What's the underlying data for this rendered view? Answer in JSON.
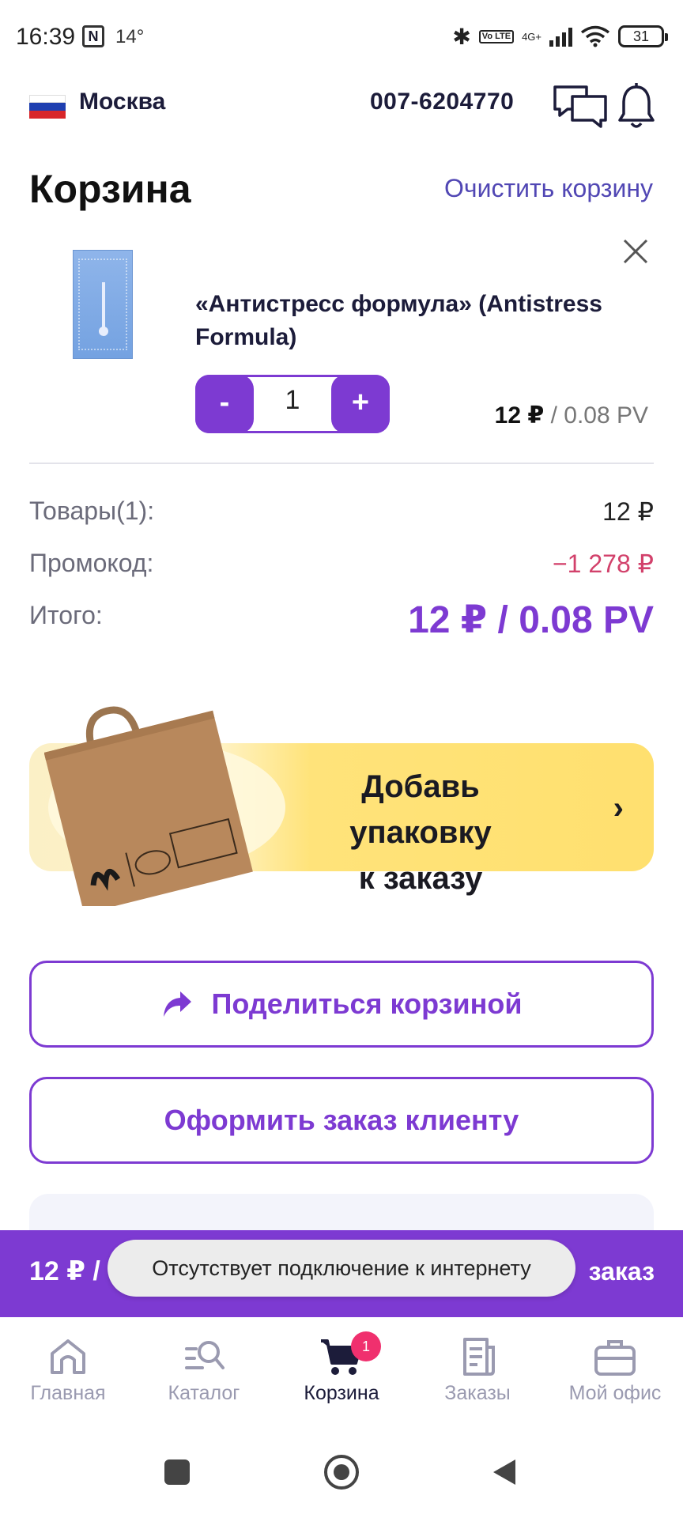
{
  "status_bar": {
    "time": "16:39",
    "nfc": "N",
    "temperature": "14°",
    "network": "4G+",
    "volte": "Vo LTE",
    "battery": "31"
  },
  "header": {
    "city": "Москва",
    "phone": "007-6204770",
    "flag_colors": [
      "#ffffff",
      "#1f3fb0",
      "#d8262a"
    ]
  },
  "page": {
    "title": "Корзина",
    "clear_label": "Очистить корзину"
  },
  "cart_item": {
    "name": "«Антистресс формула» (Antistress Formula)",
    "quantity": "1",
    "minus_label": "-",
    "plus_label": "+",
    "price": "12 ₽",
    "price_pv": " / 0.08 PV"
  },
  "summary": {
    "items_label": "Товары(1):",
    "items_value": "12 ₽",
    "promo_label": "Промокод:",
    "promo_value": "−1 278 ₽",
    "total_label": "Итого:",
    "total_value": "12 ₽ / 0.08 PV"
  },
  "packaging": {
    "line1": "Добавь упаковку",
    "line2": "к заказу",
    "chevron": "›"
  },
  "actions": {
    "share_label": "Поделиться корзиной",
    "client_order_label": "Оформить заказ клиенту"
  },
  "order_bar": {
    "price": "12 ₽ /",
    "action": "заказ"
  },
  "toast": {
    "message": "Отсутствует подключение к интернету"
  },
  "bottom_nav": {
    "items": [
      {
        "label": "Главная",
        "icon": "home-icon"
      },
      {
        "label": "Каталог",
        "icon": "catalog-search-icon"
      },
      {
        "label": "Корзина",
        "icon": "cart-icon",
        "badge": "1",
        "active": true
      },
      {
        "label": "Заказы",
        "icon": "orders-icon"
      },
      {
        "label": "Мой офис",
        "icon": "briefcase-icon"
      }
    ]
  },
  "colors": {
    "accent": "#7d3ad2",
    "link": "#5147b4",
    "promo": "#d2416b",
    "badge": "#f0306e",
    "banner": "#ffe06f"
  }
}
